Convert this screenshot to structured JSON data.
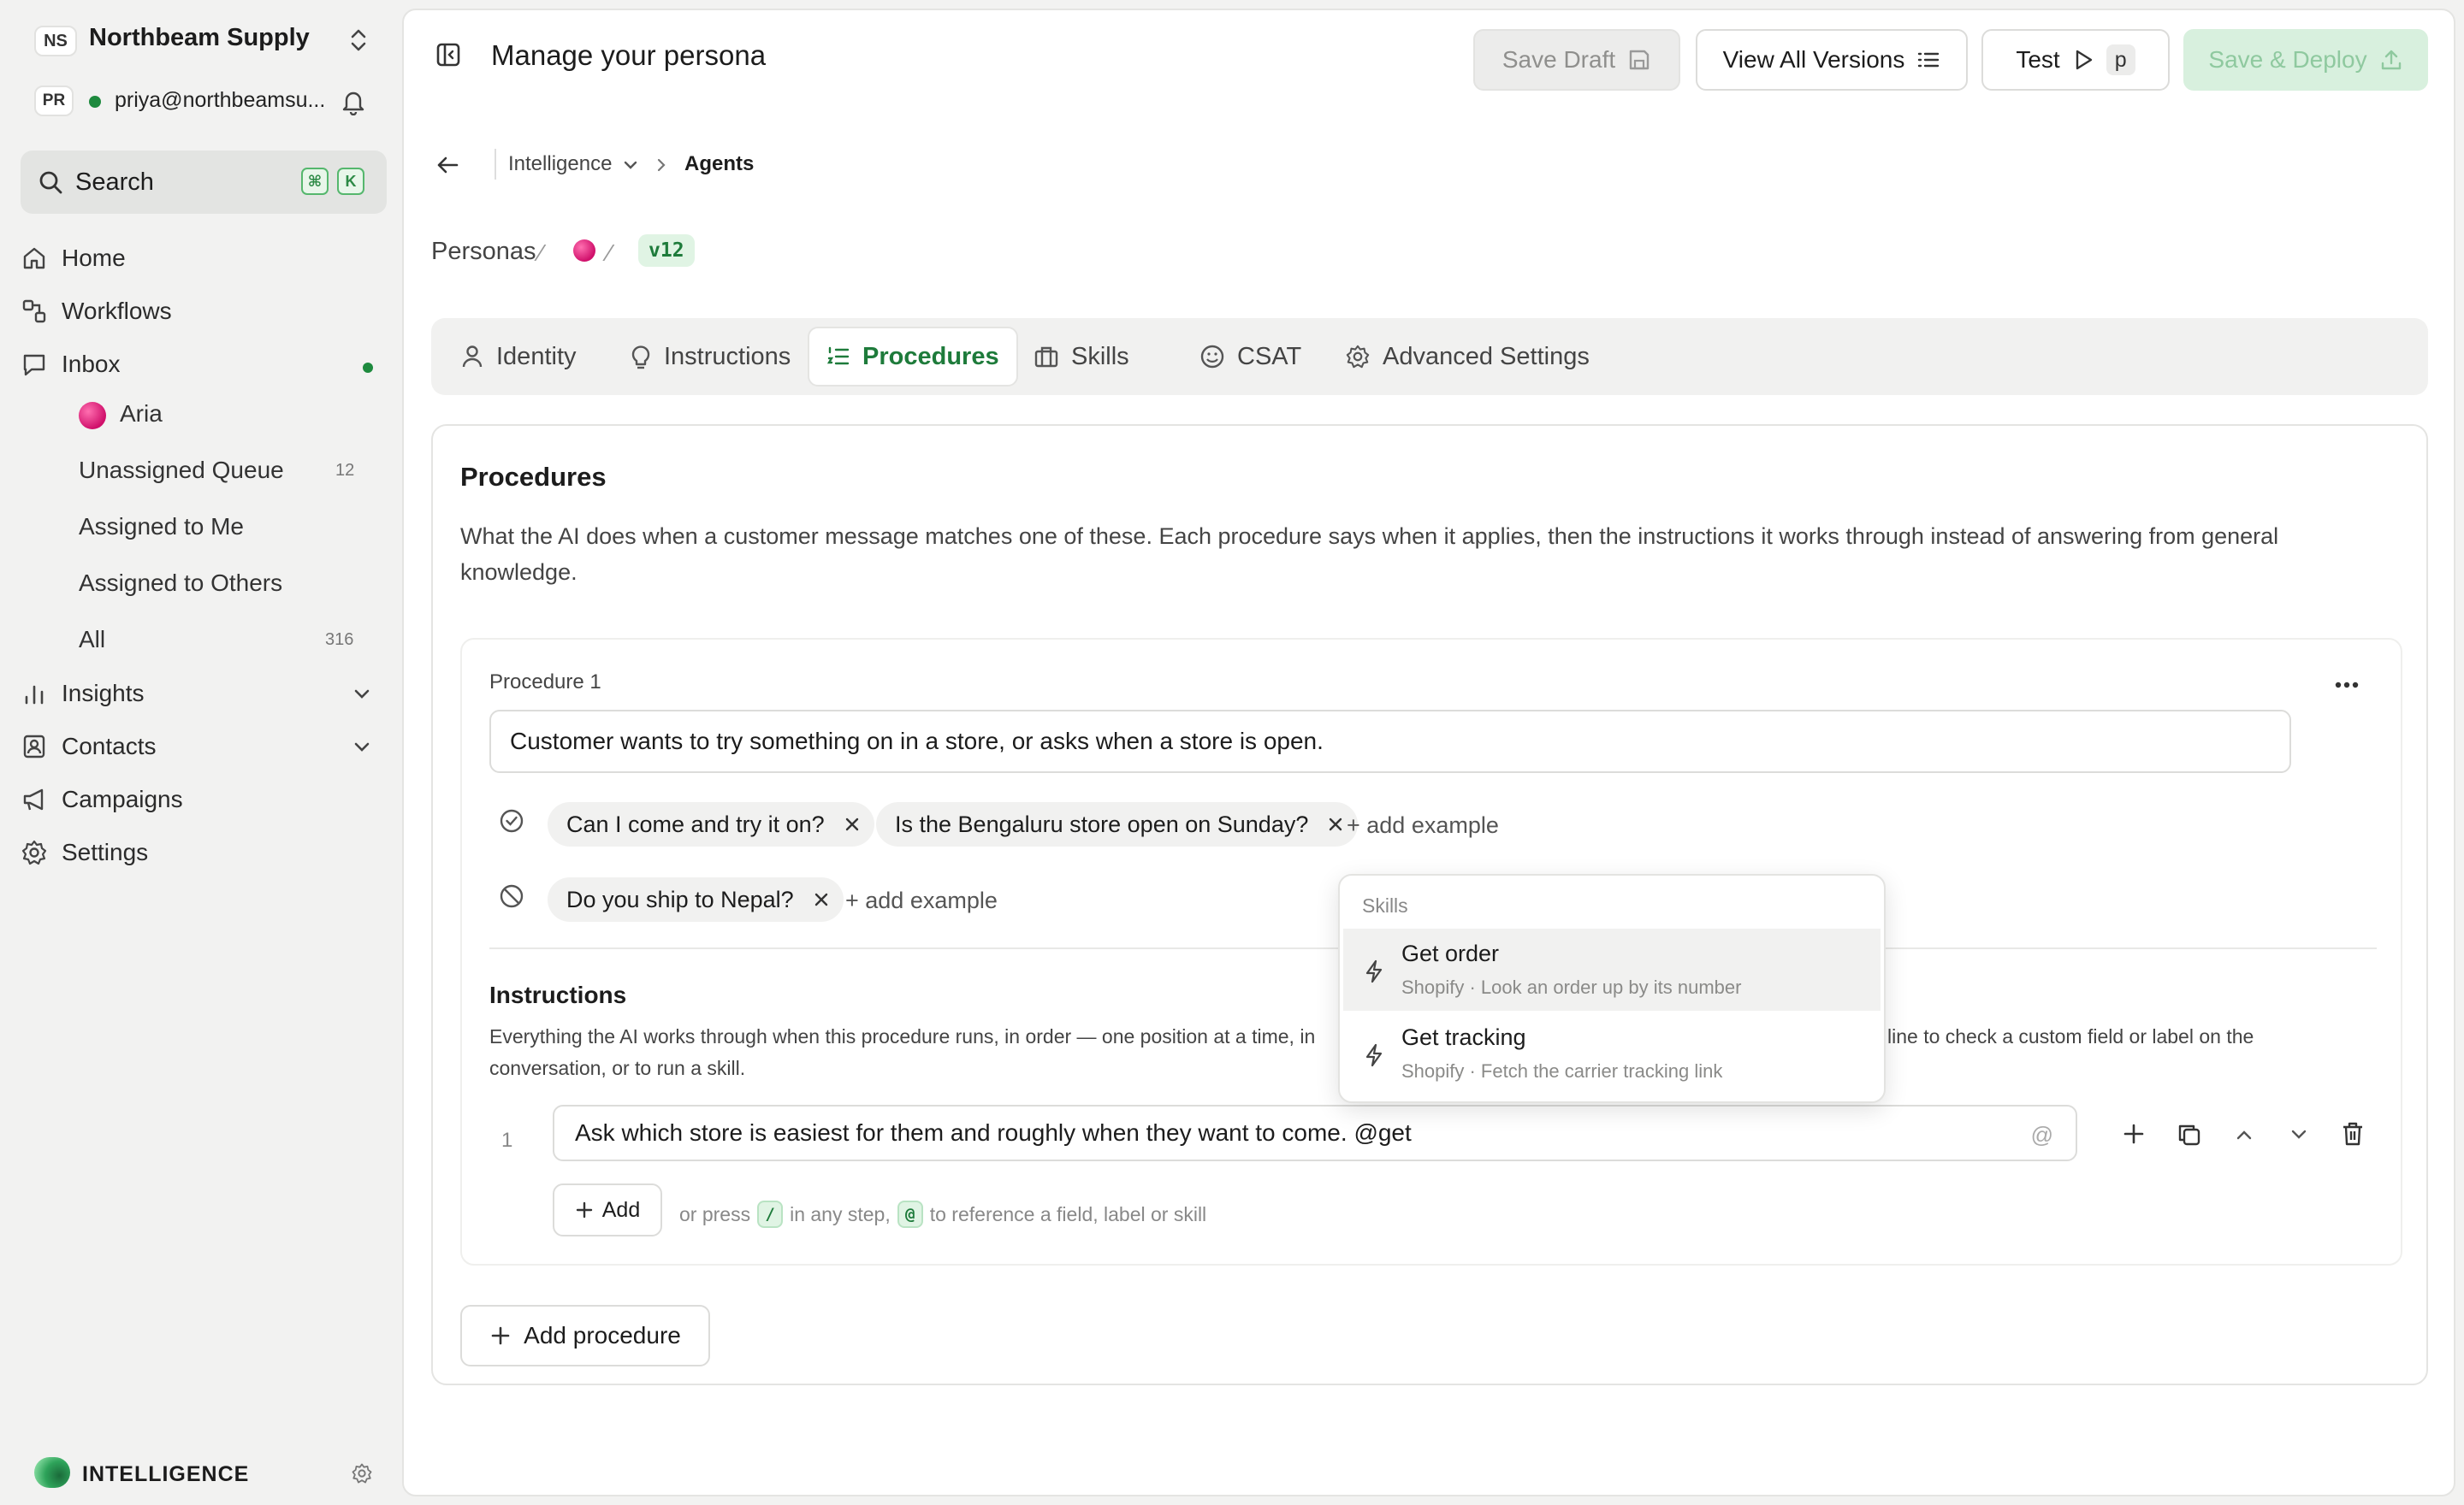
{
  "workspace": {
    "initials": "NS",
    "name": "Northbeam Supply"
  },
  "user": {
    "initials": "PR",
    "email": "priya@northbeamsu..."
  },
  "search": {
    "label": "Search",
    "key1": "⌘",
    "key2": "K"
  },
  "nav": {
    "home": "Home",
    "workflows": "Workflows",
    "inbox": "Inbox",
    "inbox_items": [
      {
        "label": "Aria"
      },
      {
        "label": "Unassigned Queue",
        "count": "12"
      },
      {
        "label": "Assigned to Me"
      },
      {
        "label": "Assigned to Others"
      },
      {
        "label": "All",
        "count": "316"
      }
    ],
    "insights": "Insights",
    "contacts": "Contacts",
    "campaigns": "Campaigns",
    "settings": "Settings"
  },
  "footer": {
    "label": "INTELLIGENCE"
  },
  "header": {
    "title": "Manage your persona",
    "save_draft": "Save Draft",
    "view_versions": "View All Versions",
    "test": "Test",
    "test_key": "p",
    "save_deploy": "Save & Deploy"
  },
  "breadcrumb": {
    "parent": "Intelligence",
    "current": "Agents"
  },
  "persona_path": {
    "root": "Personas",
    "version": "v12"
  },
  "tabs": [
    "Identity",
    "Instructions",
    "Procedures",
    "Skills",
    "CSAT",
    "Advanced Settings"
  ],
  "procedures": {
    "title": "Procedures",
    "description": "What the AI does when a customer message matches one of these. Each procedure says when it applies, then the instructions it works through instead of answering from general knowledge.",
    "item": {
      "label": "Procedure 1",
      "condition": "Customer wants to try something on in a store, or asks when a store is open.",
      "positive_examples": [
        "Can I come and try it on?",
        "Is the Bengaluru store open on Sunday?"
      ],
      "negative_examples": [
        "Do you ship to Nepal?"
      ],
      "add_example": "+ add example",
      "instructions_title": "Instructions",
      "instructions_desc_a": "Everything the AI works through when this procedure runs, in order — one position at a time, in",
      "instructions_desc_b": "line to check a custom field or label on the",
      "instructions_desc_c": "conversation, or to run a skill.",
      "step_number": "1",
      "step_text": "Ask which store is easiest for them and roughly when they want to come. @get",
      "add_label": "Add",
      "hint_a": "or press",
      "hint_key1": "/",
      "hint_b": "in any step,",
      "hint_key2": "@",
      "hint_c": "to reference a field, label or skill"
    },
    "add_procedure": "Add procedure"
  },
  "skills_popup": {
    "heading": "Skills",
    "items": [
      {
        "title": "Get order",
        "subtitle": "Shopify · Look an order up by its number"
      },
      {
        "title": "Get tracking",
        "subtitle": "Shopify · Fetch the carrier tracking link"
      }
    ]
  },
  "colors": {
    "accent": "#1e7b3b",
    "deploy_bg": "#d8f0de",
    "online": "#1e8a3e",
    "persona": "#d0106b"
  }
}
